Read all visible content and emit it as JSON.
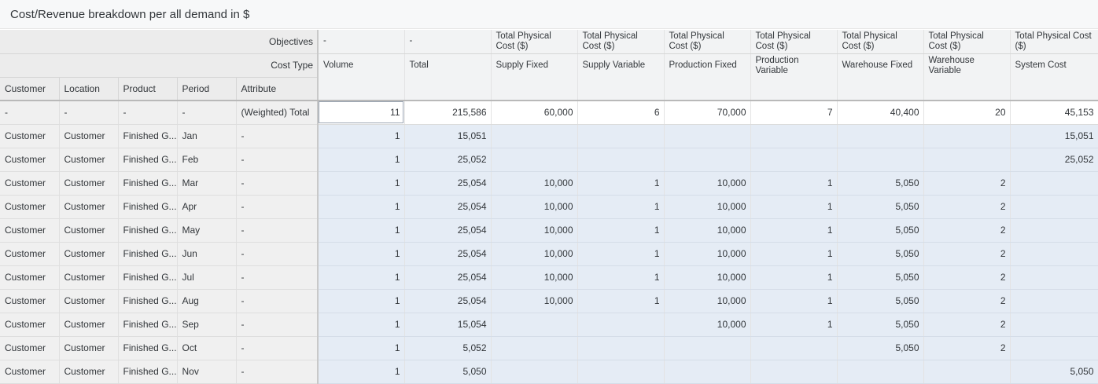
{
  "panel": {
    "title": "Cost/Revenue breakdown per all demand in $"
  },
  "header": {
    "objectives_label": "Objectives",
    "cost_type_label": "Cost Type",
    "dim_columns": [
      "Customer",
      "Location",
      "Product",
      "Period",
      "Attribute"
    ],
    "measure_columns": [
      {
        "objective": "-",
        "cost_type": "Volume"
      },
      {
        "objective": "-",
        "cost_type": "Total"
      },
      {
        "objective": "Total Physical Cost ($)",
        "cost_type": "Supply Fixed"
      },
      {
        "objective": "Total Physical Cost ($)",
        "cost_type": "Supply Variable"
      },
      {
        "objective": "Total Physical Cost ($)",
        "cost_type": "Production Fixed"
      },
      {
        "objective": "Total Physical Cost ($)",
        "cost_type": "Production Variable"
      },
      {
        "objective": "Total Physical Cost ($)",
        "cost_type": "Warehouse Fixed"
      },
      {
        "objective": "Total Physical Cost ($)",
        "cost_type": "Warehouse Variable"
      },
      {
        "objective": "Total Physical Cost ($)",
        "cost_type": "System Cost"
      }
    ]
  },
  "rows": [
    {
      "dims": [
        "-",
        "-",
        "-",
        "-",
        "(Weighted) Total"
      ],
      "values": [
        "11",
        "215,586",
        "60,000",
        "6",
        "70,000",
        "7",
        "40,400",
        "20",
        "45,153"
      ]
    },
    {
      "dims": [
        "Customer",
        "Customer",
        "Finished G...",
        "Jan",
        "-"
      ],
      "values": [
        "1",
        "15,051",
        "",
        "",
        "",
        "",
        "",
        "",
        "15,051"
      ]
    },
    {
      "dims": [
        "Customer",
        "Customer",
        "Finished G...",
        "Feb",
        "-"
      ],
      "values": [
        "1",
        "25,052",
        "",
        "",
        "",
        "",
        "",
        "",
        "25,052"
      ]
    },
    {
      "dims": [
        "Customer",
        "Customer",
        "Finished G...",
        "Mar",
        "-"
      ],
      "values": [
        "1",
        "25,054",
        "10,000",
        "1",
        "10,000",
        "1",
        "5,050",
        "2",
        ""
      ]
    },
    {
      "dims": [
        "Customer",
        "Customer",
        "Finished G...",
        "Apr",
        "-"
      ],
      "values": [
        "1",
        "25,054",
        "10,000",
        "1",
        "10,000",
        "1",
        "5,050",
        "2",
        ""
      ]
    },
    {
      "dims": [
        "Customer",
        "Customer",
        "Finished G...",
        "May",
        "-"
      ],
      "values": [
        "1",
        "25,054",
        "10,000",
        "1",
        "10,000",
        "1",
        "5,050",
        "2",
        ""
      ]
    },
    {
      "dims": [
        "Customer",
        "Customer",
        "Finished G...",
        "Jun",
        "-"
      ],
      "values": [
        "1",
        "25,054",
        "10,000",
        "1",
        "10,000",
        "1",
        "5,050",
        "2",
        ""
      ]
    },
    {
      "dims": [
        "Customer",
        "Customer",
        "Finished G...",
        "Jul",
        "-"
      ],
      "values": [
        "1",
        "25,054",
        "10,000",
        "1",
        "10,000",
        "1",
        "5,050",
        "2",
        ""
      ]
    },
    {
      "dims": [
        "Customer",
        "Customer",
        "Finished G...",
        "Aug",
        "-"
      ],
      "values": [
        "1",
        "25,054",
        "10,000",
        "1",
        "10,000",
        "1",
        "5,050",
        "2",
        ""
      ]
    },
    {
      "dims": [
        "Customer",
        "Customer",
        "Finished G...",
        "Sep",
        "-"
      ],
      "values": [
        "1",
        "15,054",
        "",
        "",
        "10,000",
        "1",
        "5,050",
        "2",
        ""
      ]
    },
    {
      "dims": [
        "Customer",
        "Customer",
        "Finished G...",
        "Oct",
        "-"
      ],
      "values": [
        "1",
        "5,052",
        "",
        "",
        "",
        "",
        "5,050",
        "2",
        ""
      ]
    },
    {
      "dims": [
        "Customer",
        "Customer",
        "Finished G...",
        "Nov",
        "-"
      ],
      "values": [
        "1",
        "5,050",
        "",
        "",
        "",
        "",
        "",
        "",
        "5,050"
      ]
    }
  ]
}
